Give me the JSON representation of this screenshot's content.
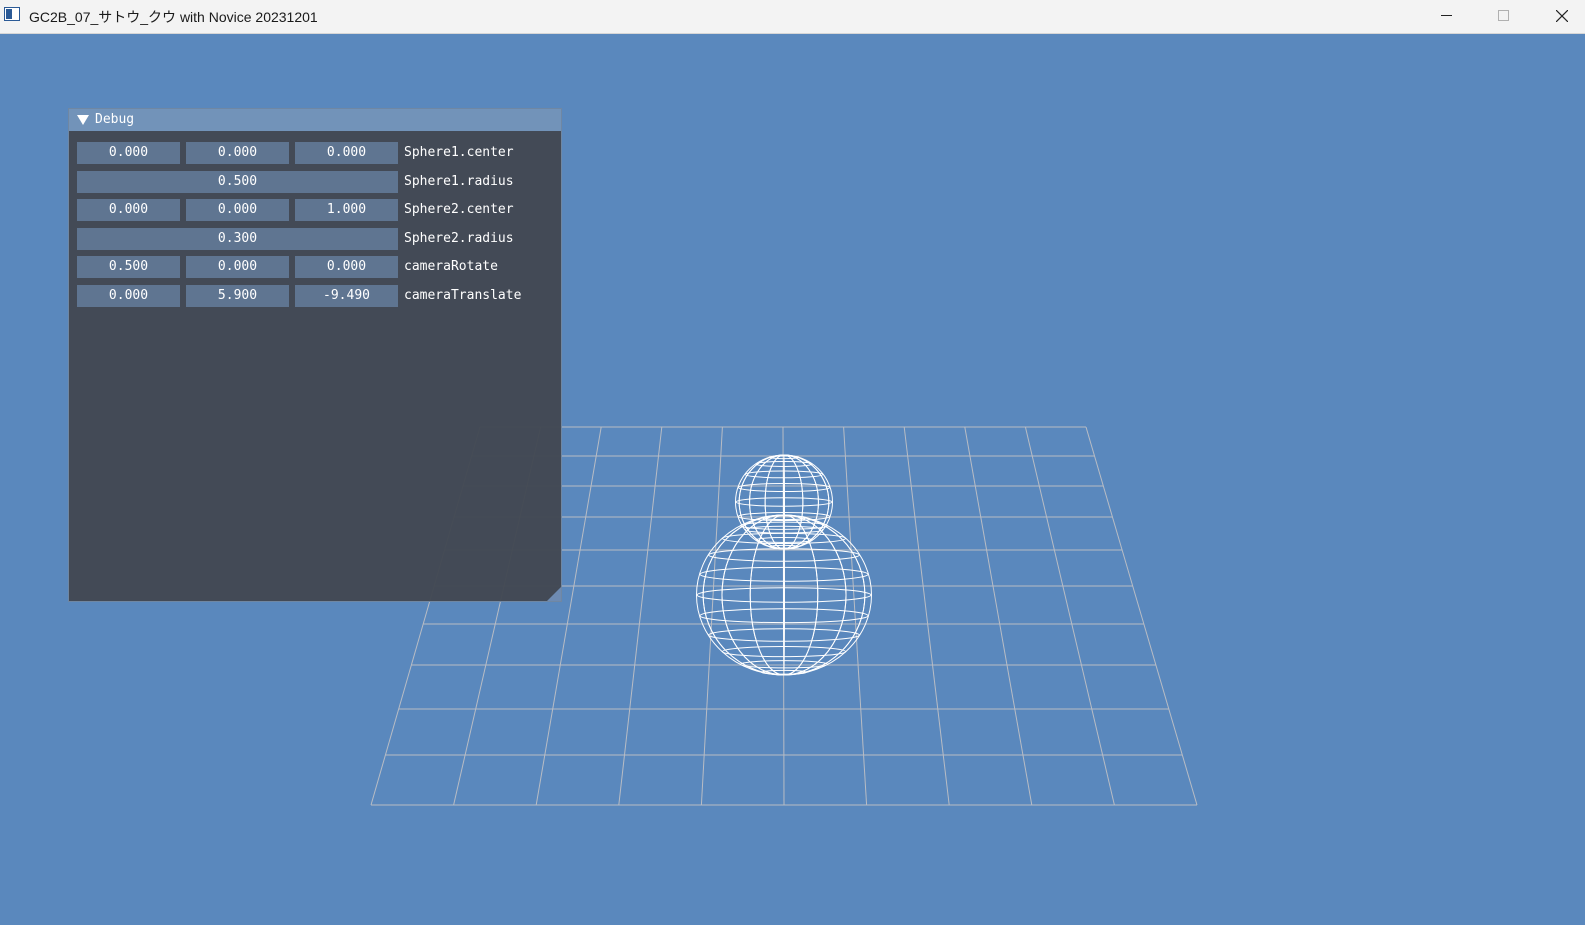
{
  "window": {
    "title": "GC2B_07_サトウ_クウ with Novice 20231201",
    "controls": [
      "minimize-icon",
      "maximize-icon",
      "close-icon"
    ]
  },
  "debug": {
    "title": "Debug",
    "rows": [
      {
        "label": "Sphere1.center",
        "values": [
          "0.000",
          "0.000",
          "0.000"
        ]
      },
      {
        "label": "Sphere1.radius",
        "values": [
          "0.500"
        ]
      },
      {
        "label": "Sphere2.center",
        "values": [
          "0.000",
          "0.000",
          "1.000"
        ]
      },
      {
        "label": "Sphere2.radius",
        "values": [
          "0.300"
        ]
      },
      {
        "label": "cameraRotate",
        "values": [
          "0.500",
          "0.000",
          "0.000"
        ]
      },
      {
        "label": "cameraTranslate",
        "values": [
          "0.000",
          "5.900",
          "-9.490"
        ]
      }
    ]
  },
  "colors": {
    "background": "#5a88bd",
    "grid_line": "#b8bcc4",
    "sphere_wire": "#ffffff",
    "panel_bg": "#424853",
    "panel_header": "#7293b9",
    "field_bg": "#5f7591"
  }
}
